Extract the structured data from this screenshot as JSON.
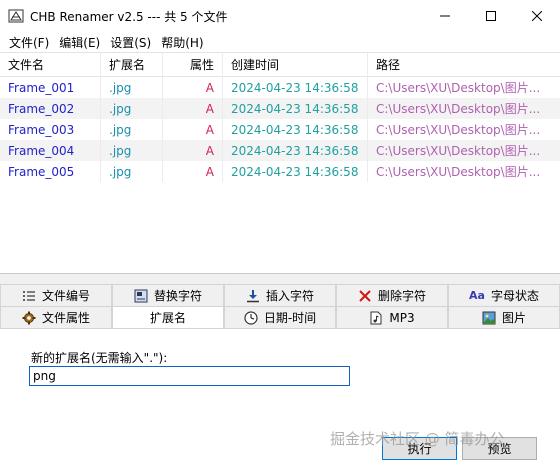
{
  "window": {
    "title": "CHB Renamer v2.5 --- 共 5 个文件"
  },
  "menu": [
    {
      "label": "文件(F)"
    },
    {
      "label": "编辑(E)"
    },
    {
      "label": "设置(S)"
    },
    {
      "label": "帮助(H)"
    }
  ],
  "grid": {
    "columns": [
      "文件名",
      "扩展名",
      "属性",
      "创建时间",
      "路径"
    ],
    "rows": [
      {
        "name": "Frame_001",
        "ext": ".jpg",
        "attr": "A",
        "time": "2024-04-23 14:36:58",
        "path": "C:\\Users\\XU\\Desktop\\图片..."
      },
      {
        "name": "Frame_002",
        "ext": ".jpg",
        "attr": "A",
        "time": "2024-04-23 14:36:58",
        "path": "C:\\Users\\XU\\Desktop\\图片..."
      },
      {
        "name": "Frame_003",
        "ext": ".jpg",
        "attr": "A",
        "time": "2024-04-23 14:36:58",
        "path": "C:\\Users\\XU\\Desktop\\图片..."
      },
      {
        "name": "Frame_004",
        "ext": ".jpg",
        "attr": "A",
        "time": "2024-04-23 14:36:58",
        "path": "C:\\Users\\XU\\Desktop\\图片..."
      },
      {
        "name": "Frame_005",
        "ext": ".jpg",
        "attr": "A",
        "time": "2024-04-23 14:36:58",
        "path": "C:\\Users\\XU\\Desktop\\图片..."
      }
    ]
  },
  "tabs": {
    "row1": [
      {
        "label": "文件编号",
        "icon": "list-numbered-icon"
      },
      {
        "label": "替换字符",
        "icon": "replace-icon"
      },
      {
        "label": "插入字符",
        "icon": "insert-arrow-icon"
      },
      {
        "label": "删除字符",
        "icon": "delete-x-icon"
      },
      {
        "label": "字母状态",
        "icon": "letter-case-icon",
        "icon_text": "Aa"
      }
    ],
    "row2": [
      {
        "label": "文件属性",
        "icon": "gear-icon"
      },
      {
        "label": "扩展名",
        "icon": "",
        "active": true
      },
      {
        "label": "日期-时间",
        "icon": "clock-icon"
      },
      {
        "label": "MP3",
        "icon": "music-file-icon"
      },
      {
        "label": "图片",
        "icon": "image-icon"
      }
    ]
  },
  "panel": {
    "label": "新的扩展名(无需输入\".\"):",
    "value": "png",
    "run_label": "执行",
    "preview_label": "预览"
  },
  "watermark": "掘金技术社区 @ 简毒办公",
  "colors": {
    "name": "#2222cc",
    "ext": "#1a8fb0",
    "attr": "#d62050",
    "time": "#20a0a0",
    "path": "#b060b0"
  }
}
